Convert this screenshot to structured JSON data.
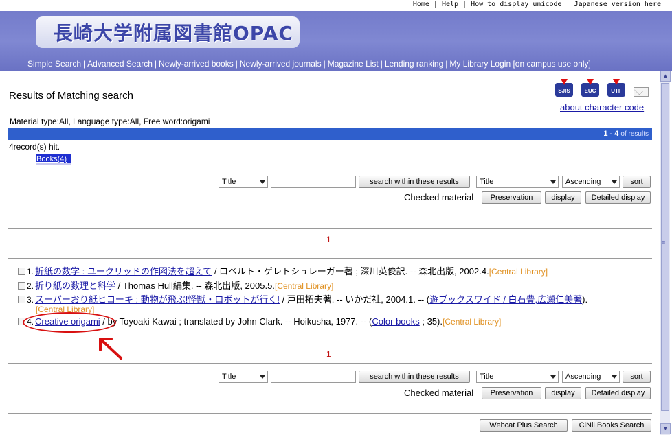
{
  "header": {
    "top_links": [
      "Home",
      "Help",
      "How to display unicode",
      "Japanese version here"
    ],
    "logo": "長崎大学附属図書館OPAC",
    "nav": [
      "Simple Search",
      "Advanced Search",
      "Newly-arrived books",
      "Newly-arrived journals",
      "Magazine List",
      "Lending ranking",
      "My Library Login [on campus use only]"
    ]
  },
  "page": {
    "title": "Results of Matching search",
    "encoding_icons": [
      "SJIS",
      "EUC",
      "UTF"
    ],
    "about_link": "about character code",
    "criteria": "Material type:All, Language type:All, Free word:origami",
    "range_label": "1 - 4",
    "range_suffix": "of results",
    "hits": "4record(s) hit.",
    "books_tab": "Books(4)"
  },
  "toolbar": {
    "field_select": "Title",
    "search_within": "search within these results",
    "sort_field": "Title",
    "sort_order": "Ascending",
    "sort_btn": "sort",
    "checked_label": "Checked material",
    "preservation": "Preservation",
    "display": "display",
    "detailed_display": "Detailed display"
  },
  "pagination": "1",
  "records": [
    {
      "num": "1.",
      "title": "折紙の数学 : ユークリッドの作図法を超えて",
      "rest": " / ロベルト・ゲレトシュレーガー著 ; 深川英俊訳. -- 森北出版, 2002.4.",
      "library": "[Central Library]"
    },
    {
      "num": "2.",
      "title": "折り紙の数理と科学",
      "rest": " / Thomas Hull編集. -- 森北出版, 2005.5.",
      "library": "[Central Library]"
    },
    {
      "num": "3.",
      "title": "スーパーおり紙ヒコーキ : 動物が飛ぶ!怪獣・ロボットが行く!",
      "rest": " / 戸田拓夫著. -- いかだ社, 2004.1. -- (",
      "series": "遊ブックスワイド / 白石豊,広瀬仁美著",
      "rest2": ").",
      "library": "[Central Library]"
    },
    {
      "num": "4.",
      "title": "Creative origami",
      "rest": " / by Toyoaki Kawai ; translated by John Clark. -- Hoikusha, 1977. -- (",
      "series": "Color books",
      "rest2": " ; 35).",
      "library": "[Central Library]"
    }
  ],
  "bottom_buttons": [
    "Webcat Plus Search",
    "CiNii Books Search"
  ],
  "colors": {
    "header": "#7078c8",
    "result_bar": "#2f5fcc",
    "library": "#e09020",
    "annotation": "#d81010"
  }
}
